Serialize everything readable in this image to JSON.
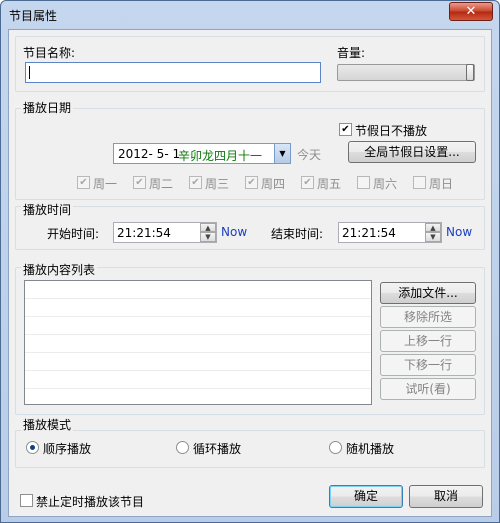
{
  "window": {
    "title": "节目属性",
    "close_glyph": "✕"
  },
  "program": {
    "name_label": "节目名称:",
    "name_value": "",
    "volume_label": "音量:",
    "volume_level": 1.0
  },
  "date": {
    "group_label": "播放日期",
    "holiday_checkbox_label": "节假日不播放",
    "holiday_checked": true,
    "date_value": "2012- 5- 1",
    "lunar_text": "辛卯龙四月十一",
    "today_label": "今天",
    "global_holiday_button": "全局节假日设置...",
    "weekdays": [
      {
        "label": "周一",
        "checked": true
      },
      {
        "label": "周二",
        "checked": true
      },
      {
        "label": "周三",
        "checked": true
      },
      {
        "label": "周四",
        "checked": true
      },
      {
        "label": "周五",
        "checked": true
      },
      {
        "label": "周六",
        "checked": false
      },
      {
        "label": "周日",
        "checked": false
      }
    ]
  },
  "time": {
    "group_label": "播放时间",
    "start_label": "开始时间:",
    "start_value": "21:21:54",
    "end_label": "结束时间:",
    "end_value": "21:21:54",
    "now_label": "Now"
  },
  "content": {
    "group_label": "播放内容列表",
    "buttons": [
      "添加文件...",
      "移除所选",
      "上移一行",
      "下移一行",
      "试听(看)"
    ]
  },
  "mode": {
    "group_label": "播放模式",
    "options": [
      "顺序播放",
      "循环播放",
      "随机播放"
    ],
    "selected": 0
  },
  "footer": {
    "disable_checkbox_label": "禁止定时播放该节目",
    "ok_button": "确定",
    "cancel_button": "取消"
  }
}
